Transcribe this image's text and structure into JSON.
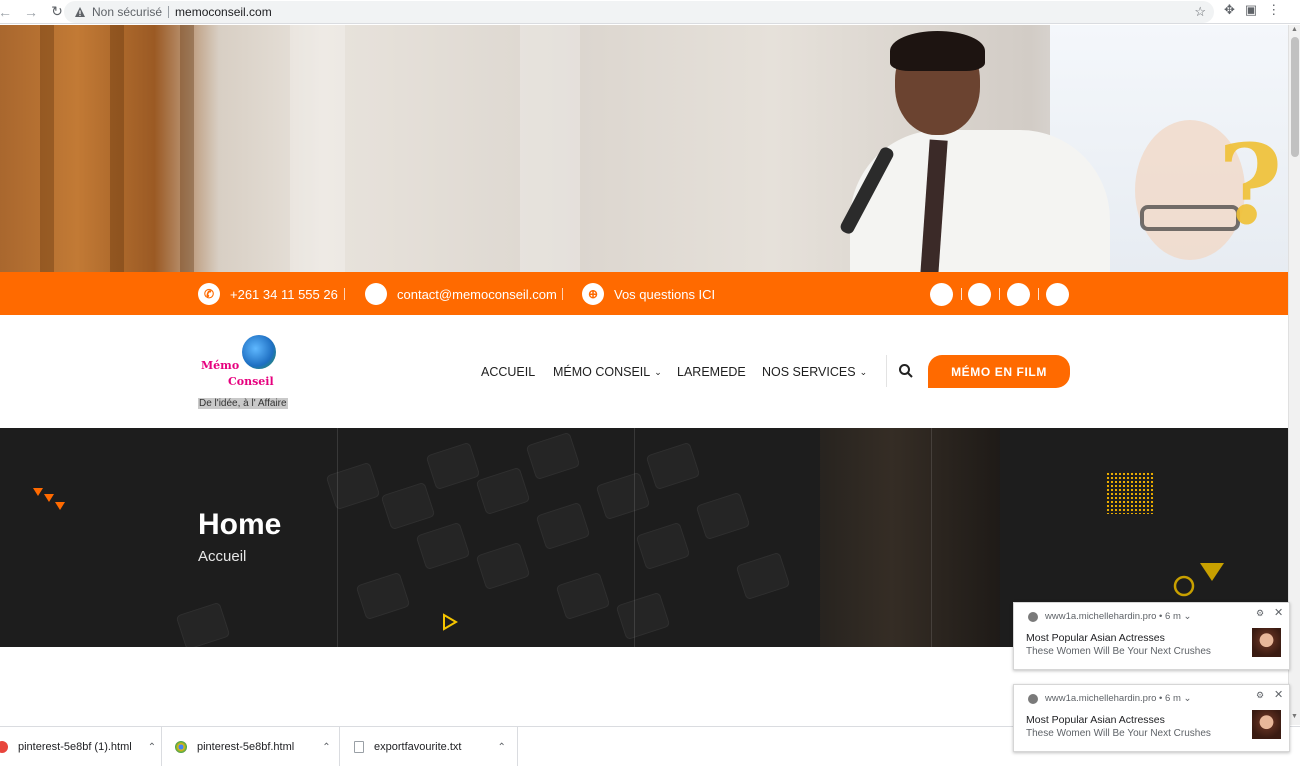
{
  "browser": {
    "security_label": "Non sécurisé",
    "url": "memoconseil.com"
  },
  "topbar": {
    "phone": "+261 34 11 555 26",
    "email": "contact@memoconseil.com",
    "questions": "Vos questions ICI",
    "accent_color": "#ff6a00"
  },
  "logo": {
    "line1": "Mémo",
    "line2": "Conseil",
    "tagline": "De l'idée, à l' Affaire"
  },
  "nav": {
    "items": [
      {
        "label": "ACCUEIL"
      },
      {
        "label": "MÉMO CONSEIL"
      },
      {
        "label": "LAREMEDE"
      },
      {
        "label": "NOS SERVICES"
      }
    ],
    "cta_label": "MÉMO EN FILM"
  },
  "banner": {
    "title": "Home",
    "subtitle": "Accueil"
  },
  "downloads": [
    {
      "name": "pinterest-5e8bf (1).html"
    },
    {
      "name": "pinterest-5e8bf.html"
    },
    {
      "name": "exportfavourite.txt"
    }
  ],
  "notifications": [
    {
      "source": "www1a.michellehardin.pro",
      "time": "6 m",
      "title": "Most Popular Asian Actresses",
      "body": "These Women Will Be Your Next Crushes"
    },
    {
      "source": "www1a.michellehardin.pro",
      "time": "6 m",
      "title": "Most Popular Asian Actresses",
      "body": "These Women Will Be Your Next Crushes"
    }
  ]
}
